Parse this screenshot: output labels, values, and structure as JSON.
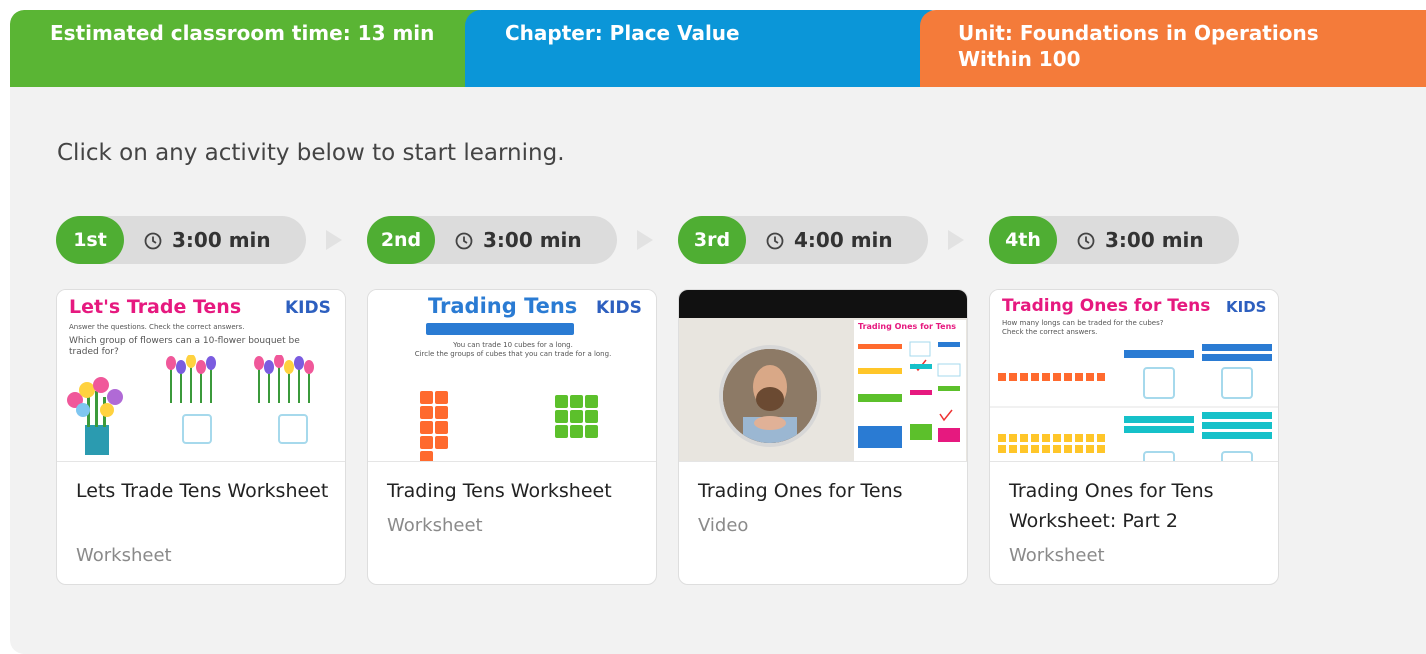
{
  "banners": {
    "time": "Estimated classroom time: 13 min",
    "chapter": "Chapter: Place Value",
    "unit_line1": "Unit: Foundations in Operations",
    "unit_line2": "Within 100"
  },
  "intro": "Click on any activity below to start learning.",
  "steps": [
    {
      "ordinal": "1st",
      "duration": "3:00 min"
    },
    {
      "ordinal": "2nd",
      "duration": "3:00 min"
    },
    {
      "ordinal": "3rd",
      "duration": "4:00 min"
    },
    {
      "ordinal": "4th",
      "duration": "3:00 min"
    }
  ],
  "cards": [
    {
      "title": "Lets Trade Tens Worksheet",
      "type": "Worksheet",
      "thumb_title": "Let's Trade Tens",
      "thumb_text1": "Answer the questions. Check the correct answers.",
      "thumb_text2": "Which group of flowers can a 10-flower bouquet be traded for?"
    },
    {
      "title": "Trading Tens Worksheet",
      "type": "Worksheet",
      "thumb_title": "Trading Tens",
      "thumb_text1": "You can trade 10 cubes for a long.",
      "thumb_text2": "Circle the groups of cubes that you can trade for a long."
    },
    {
      "title": "Trading Ones for Tens",
      "type": "Video",
      "thumb_title": "Trading Ones for Tens"
    },
    {
      "title": "Trading Ones for Tens Worksheet: Part 2",
      "type": "Worksheet",
      "thumb_title": "Trading Ones for Tens",
      "thumb_text1": "How many longs can be traded for the cubes?",
      "thumb_text2": "Check the correct answers."
    }
  ],
  "logo_text": "KIDS",
  "colors": {
    "green": "#5ab534",
    "blue": "#0b96d8",
    "orange": "#f47b3a",
    "pink": "#e6197f",
    "thumb_blue": "#2a7bd3"
  }
}
